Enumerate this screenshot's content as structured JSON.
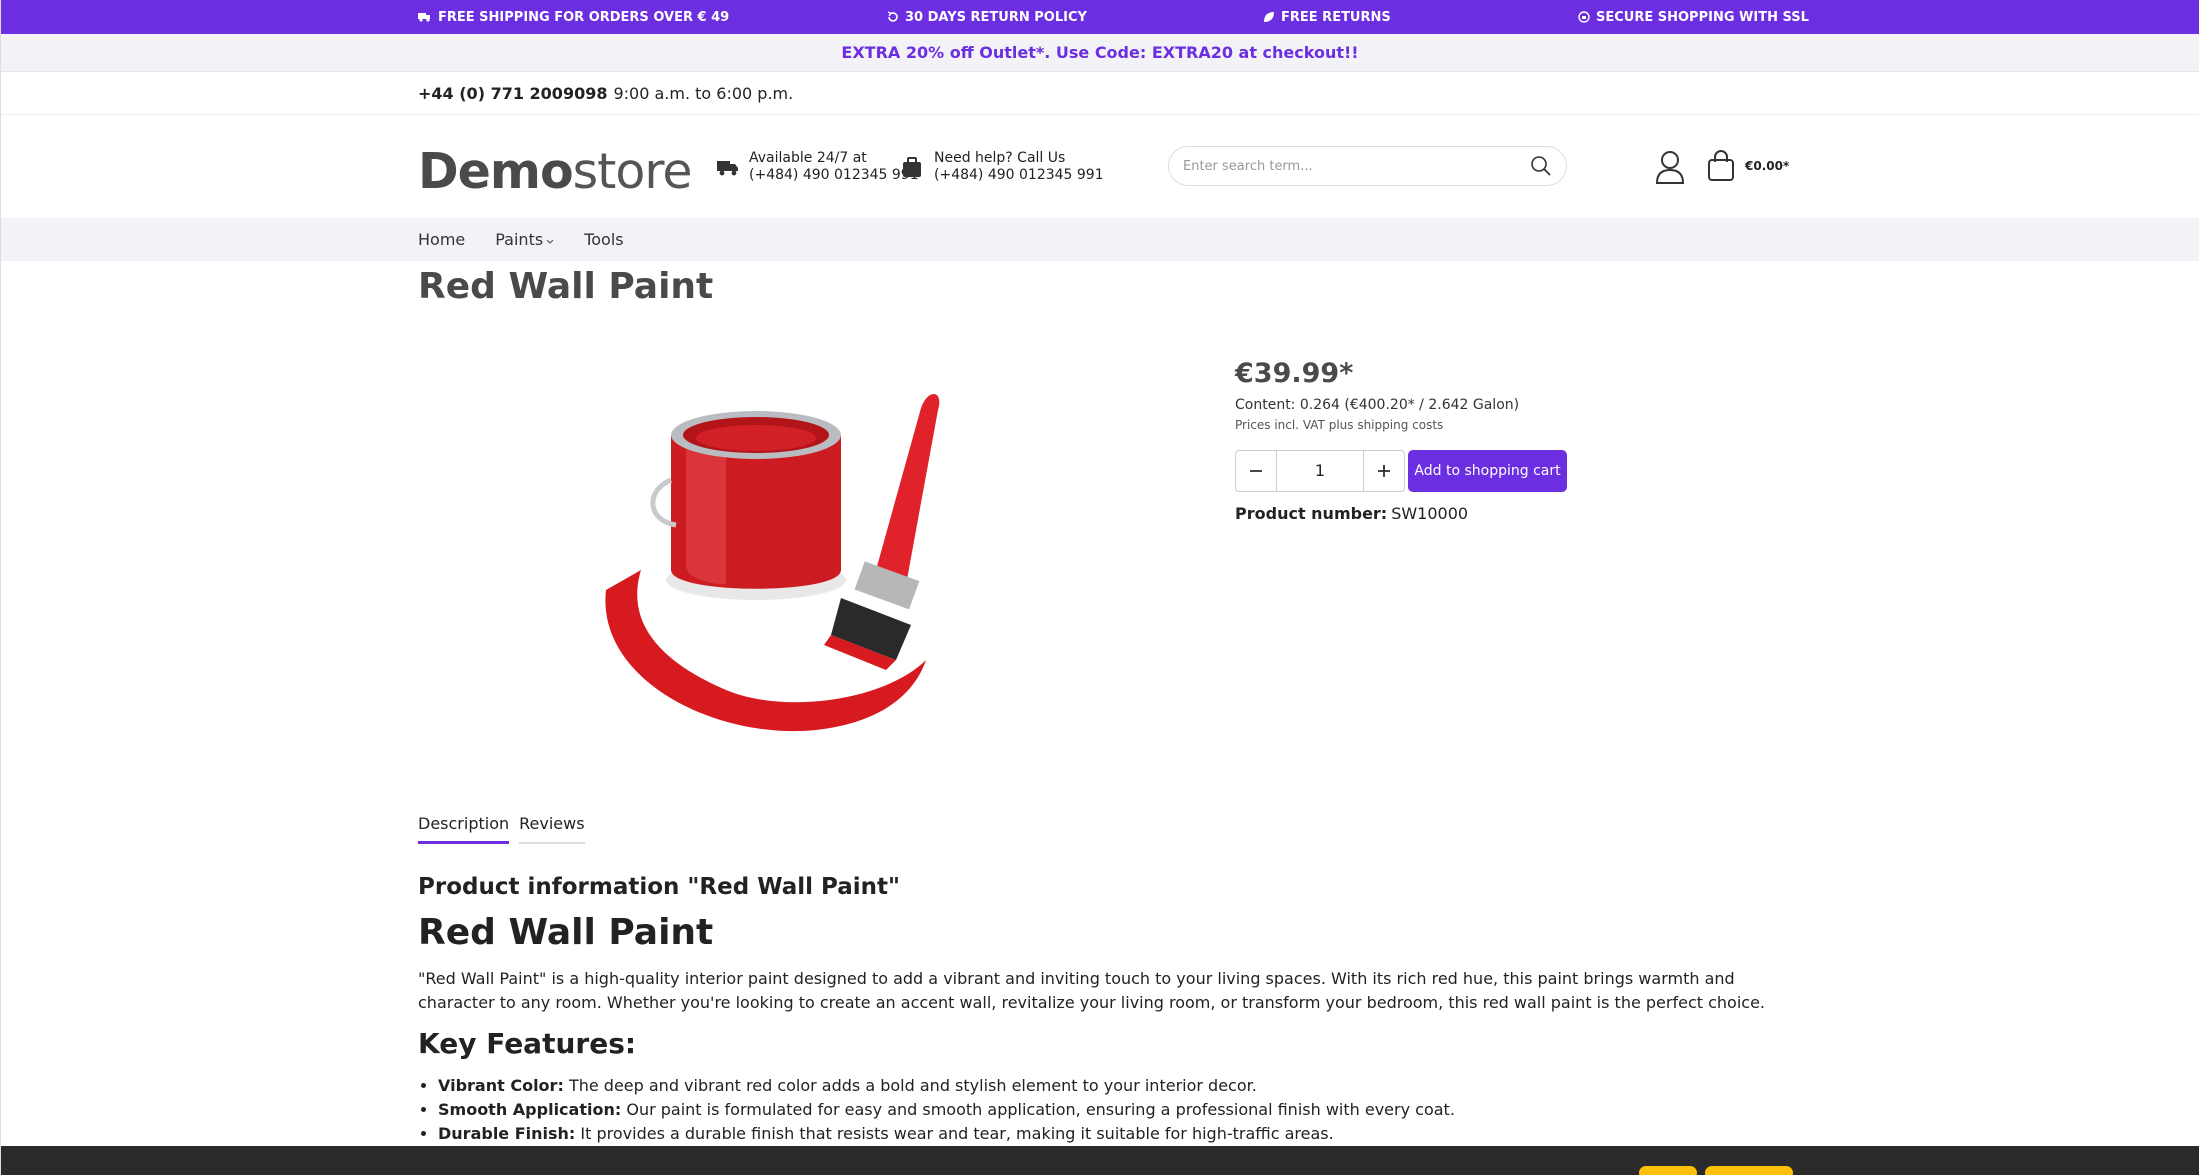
{
  "topbar": {
    "items": [
      {
        "icon": "truck-icon",
        "label": "FREE SHIPPING FOR ORDERS OVER € 49"
      },
      {
        "icon": "return-icon",
        "label": "30 DAYS RETURN POLICY"
      },
      {
        "icon": "leaf-icon",
        "label": "FREE RETURNS"
      },
      {
        "icon": "lock-icon",
        "label": "SECURE SHOPPING WITH SSL"
      }
    ],
    "color": "#6b2ee0"
  },
  "promo": {
    "text": "EXTRA 20% off Outlet*. Use Code: EXTRA20 at checkout!!"
  },
  "contact": {
    "phone": "+44 (0) 771 2009098",
    "hours": "9:00 a.m. to 6:00 p.m."
  },
  "header": {
    "logo_bold": "Demo",
    "logo_light": "store",
    "info1": {
      "line1": "Available 24/7 at",
      "line2": "(+484) 490 012345 991"
    },
    "info2": {
      "line1": "Need help? Call Us",
      "line2": "(+484) 490 012345 991"
    },
    "search_placeholder": "Enter search term...",
    "cart_total": "€0.00*"
  },
  "nav": {
    "items": [
      "Home",
      "Paints",
      "Tools"
    ]
  },
  "product": {
    "title": "Red Wall Paint",
    "price": "€39.99*",
    "content": "Content: 0.264 (€400.20* / 2.642 Galon)",
    "vat": "Prices incl. VAT plus shipping costs",
    "quantity": "1",
    "add_to_cart": "Add to shopping cart",
    "number_label": "Product number:",
    "number_value": "SW10000"
  },
  "tabs": [
    "Description",
    "Reviews"
  ],
  "description": {
    "heading": "Product information \"Red Wall Paint\"",
    "title": "Red Wall Paint",
    "paragraph": "\"Red Wall Paint\" is a high-quality interior paint designed to add a vibrant and inviting touch to your living spaces. With its rich red hue, this paint brings warmth and character to any room. Whether you're looking to create an accent wall, revitalize your living room, or transform your bedroom, this red wall paint is the perfect choice.",
    "features_heading": "Key Features:",
    "features": [
      {
        "label": "Vibrant Color:",
        "text": "The deep and vibrant red color adds a bold and stylish element to your interior decor."
      },
      {
        "label": "Smooth Application:",
        "text": "Our paint is formulated for easy and smooth application, ensuring a professional finish with every coat."
      },
      {
        "label": "Durable Finish:",
        "text": "It provides a durable finish that resists wear and tear, making it suitable for high-traffic areas."
      }
    ]
  }
}
